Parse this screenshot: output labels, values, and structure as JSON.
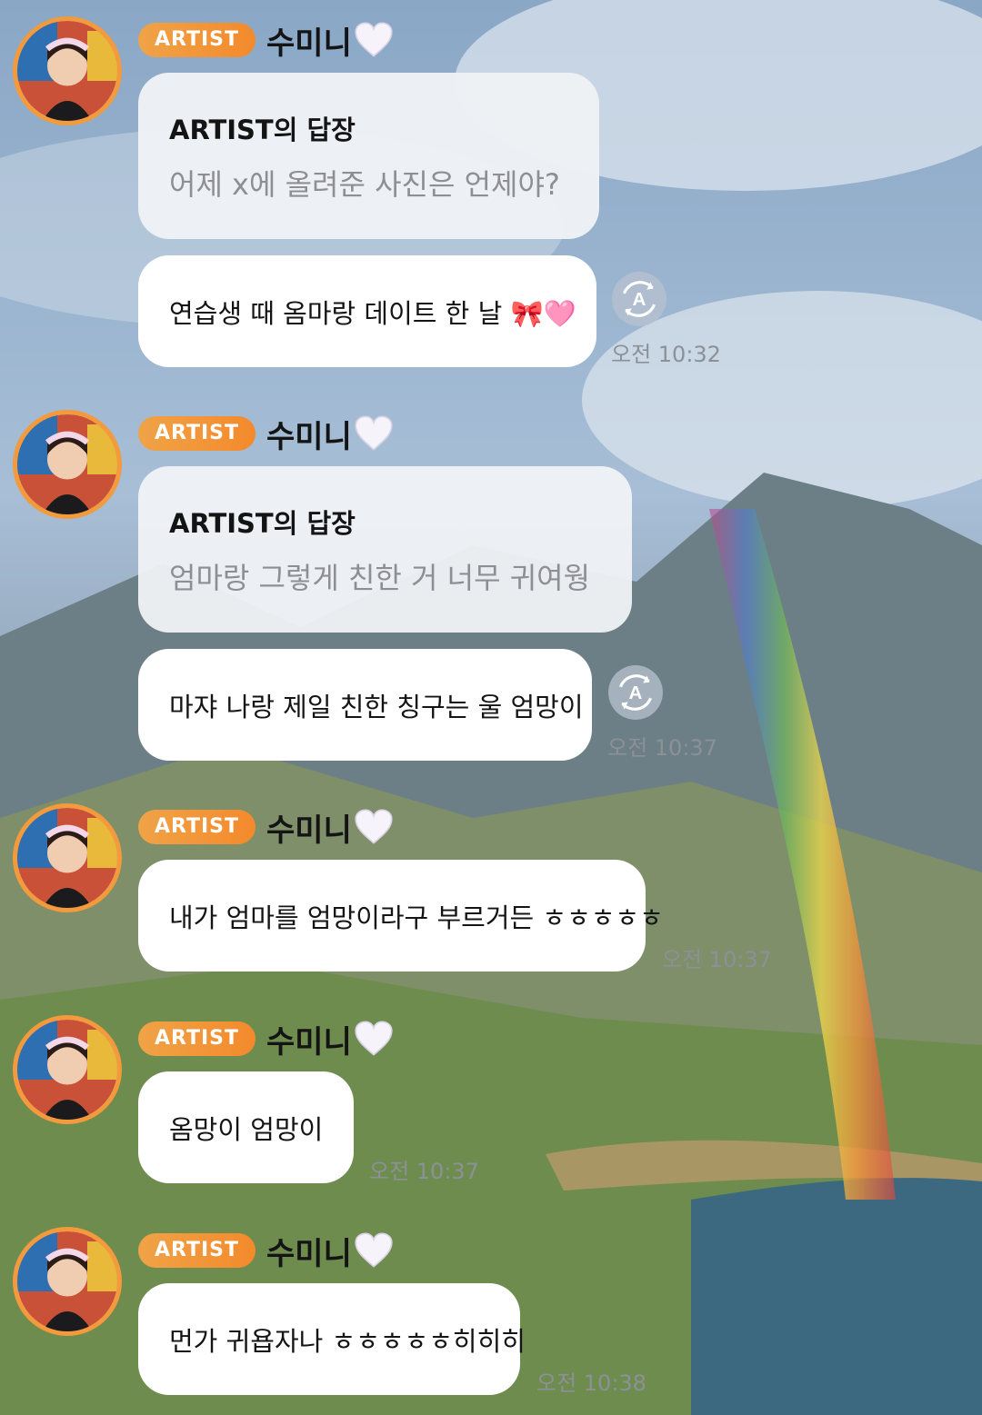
{
  "chat": {
    "badge": "ARTIST",
    "messages": [
      {
        "sender": "수미니",
        "reply": {
          "title": "ARTIST의 답장",
          "text": "어제 x에 올려준 사진은 언제야?"
        },
        "text": "연습생 때 옴마랑 데이트 한 날 🎀🩷",
        "time": "오전 10:32"
      },
      {
        "sender": "수미니",
        "reply": {
          "title": "ARTIST의 답장",
          "text": "엄마랑 그렇게 친한 거 너무 귀여웡"
        },
        "text": "마쟈 나랑 제일 친한 칭구는 울 엄망이",
        "time": "오전 10:37"
      },
      {
        "sender": "수미니",
        "text": "내가 엄마를 엄망이라구 부르거든 ㅎㅎㅎㅎㅎ",
        "time": "오전 10:37"
      },
      {
        "sender": "수미니",
        "text": "옴망이 엄망이",
        "time": "오전 10:37"
      },
      {
        "sender": "수미니",
        "text": "먼가 귀욥자나 ㅎㅎㅎㅎㅎ히히히",
        "time": "오전 10:38"
      }
    ]
  },
  "colors": {
    "badge": "#f29a3c",
    "bubble": "#ffffff",
    "reply_bubble": "#eff1f5",
    "reply_text": "#8e8f94",
    "timestamp": "#8c9097"
  },
  "icons": {
    "avatar": "profile-photo",
    "heart": "white-heart",
    "translate": "translate-a-icon"
  }
}
